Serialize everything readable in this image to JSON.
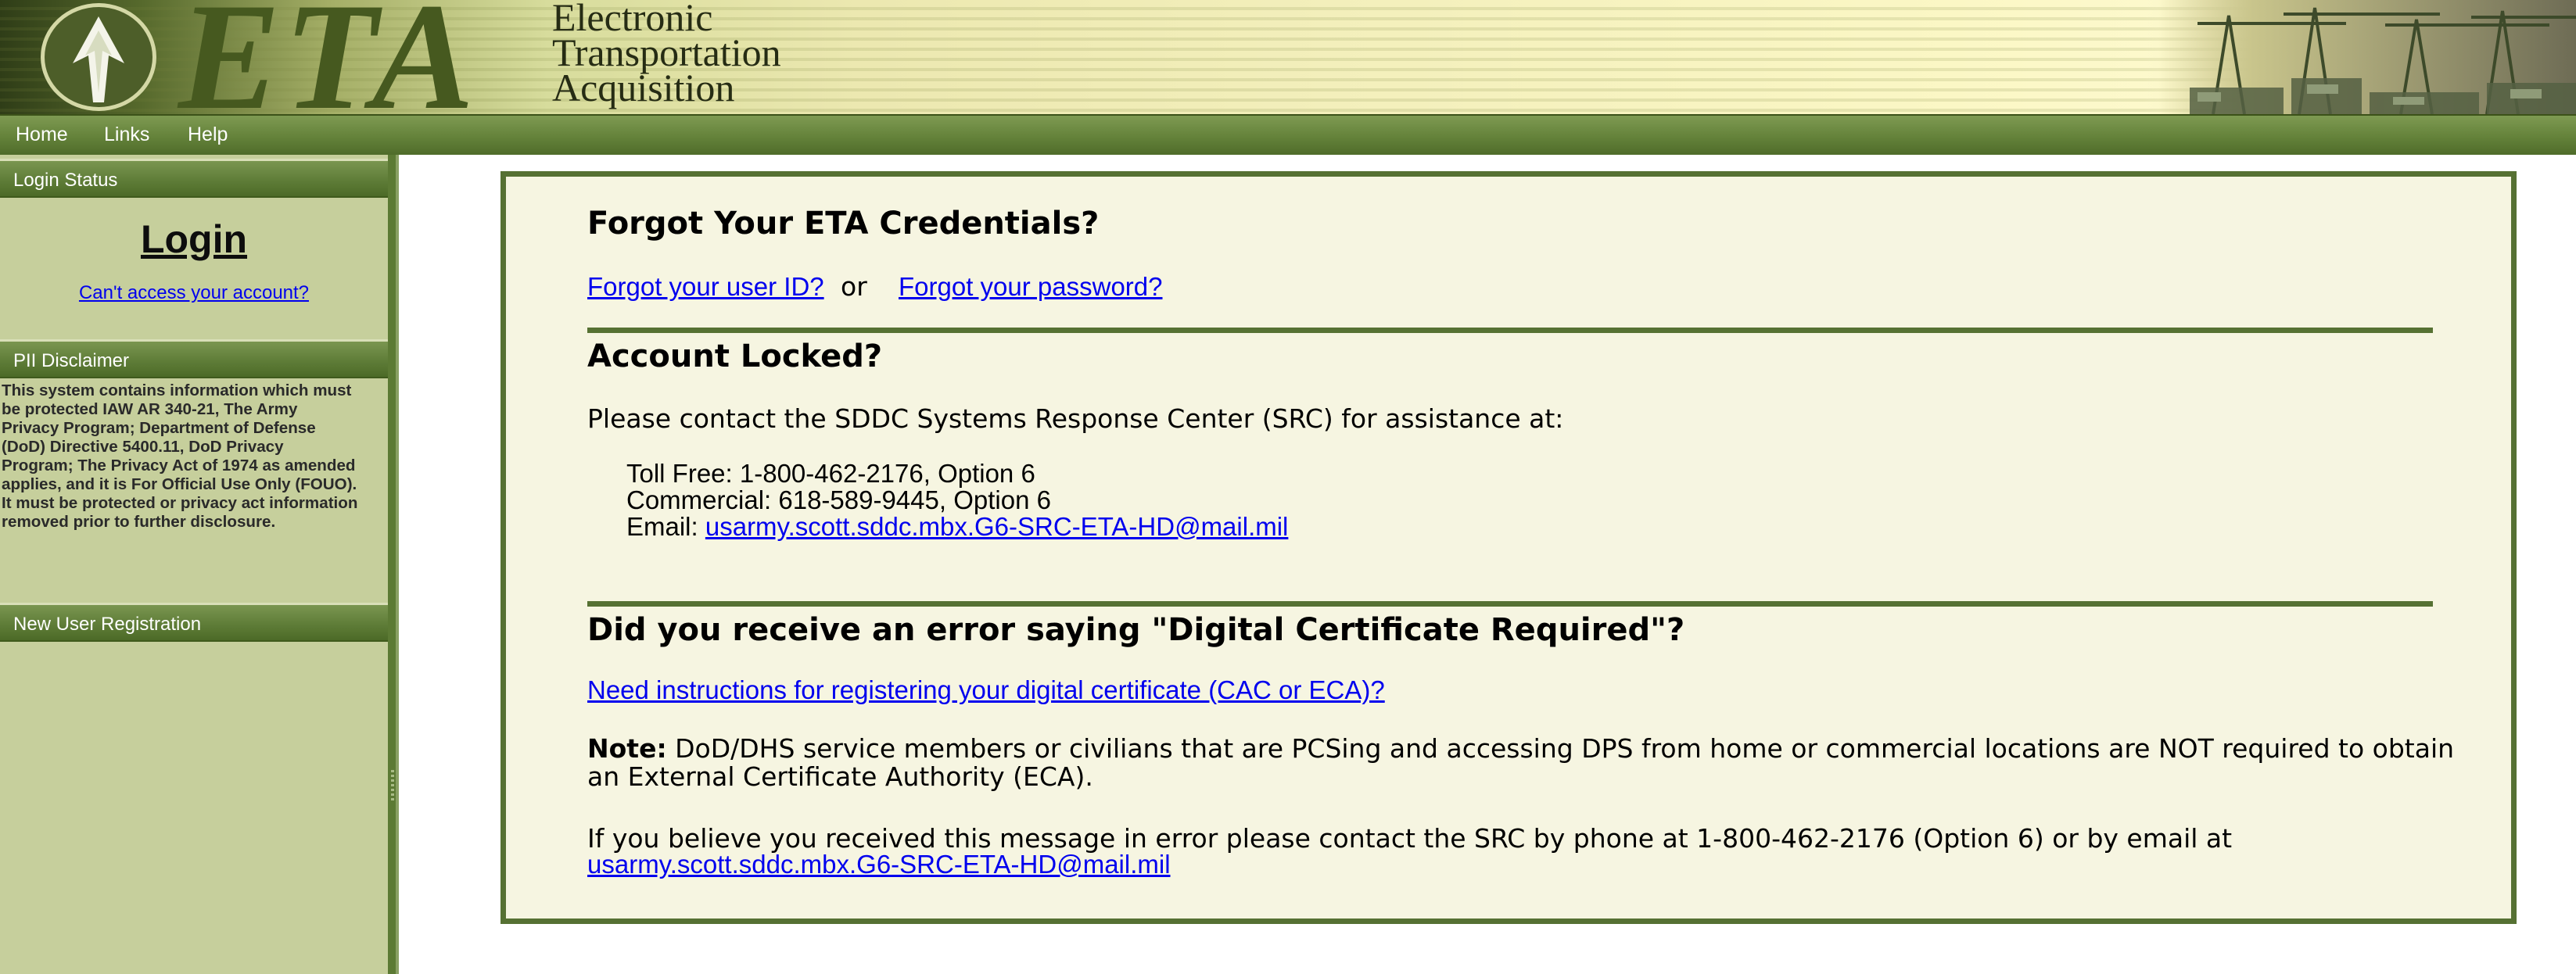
{
  "banner": {
    "logo_text": "ETA",
    "title_lines": [
      "Electronic",
      "Transportation",
      "Acquisition"
    ]
  },
  "nav": {
    "items": [
      "Home",
      "Links",
      "Help"
    ]
  },
  "sidebar": {
    "login_status_header": "Login Status",
    "login_label": "Login",
    "cant_access_link": "Can't access your account?",
    "pii_header": "PII Disclaimer",
    "pii_lines": [
      "This system contains information which must",
      "be protected IAW AR 340-21, The Army",
      "Privacy Program; Department of Defense",
      "(DoD) Directive 5400.11, DoD Privacy",
      "Program; The Privacy Act of 1974 as amended",
      "applies, and it is For Official Use Only (FOUO).",
      "It must be protected or privacy act information",
      "removed prior to further disclosure."
    ],
    "new_user_header": "New User Registration"
  },
  "main": {
    "forgot_heading": "Forgot Your ETA Credentials?",
    "forgot_userid_link": "Forgot your user ID?",
    "or_text": "or",
    "forgot_password_link": "Forgot your password?",
    "locked_heading": "Account Locked?",
    "contact_intro": "Please contact the SDDC Systems Response Center (SRC) for assistance at:",
    "toll_free": "Toll Free: 1-800-462-2176, Option 6",
    "commercial": "Commercial: 618-589-9445, Option 6",
    "email_label": "Email: ",
    "email_link": "usarmy.scott.sddc.mbx.G6-SRC-ETA-HD@mail.mil",
    "cert_heading": "Did you receive an error saying \"Digital Certificate Required\"?",
    "cert_instructions_link": "Need instructions for registering your digital certificate (CAC or ECA)?",
    "note_label": "Note:",
    "note_line1": " DoD/DHS service members or civilians that are PCSing and accessing DPS from home or commercial locations are NOT required to obtain",
    "note_line2": "an External Certificate Authority (ECA).",
    "error_text": "If you believe you received this message in error please contact the SRC by phone at 1-800-462-2176 (Option 6) or by email at",
    "error_email_link": "usarmy.scott.sddc.mbx.G6-SRC-ETA-HD@mail.mil"
  }
}
